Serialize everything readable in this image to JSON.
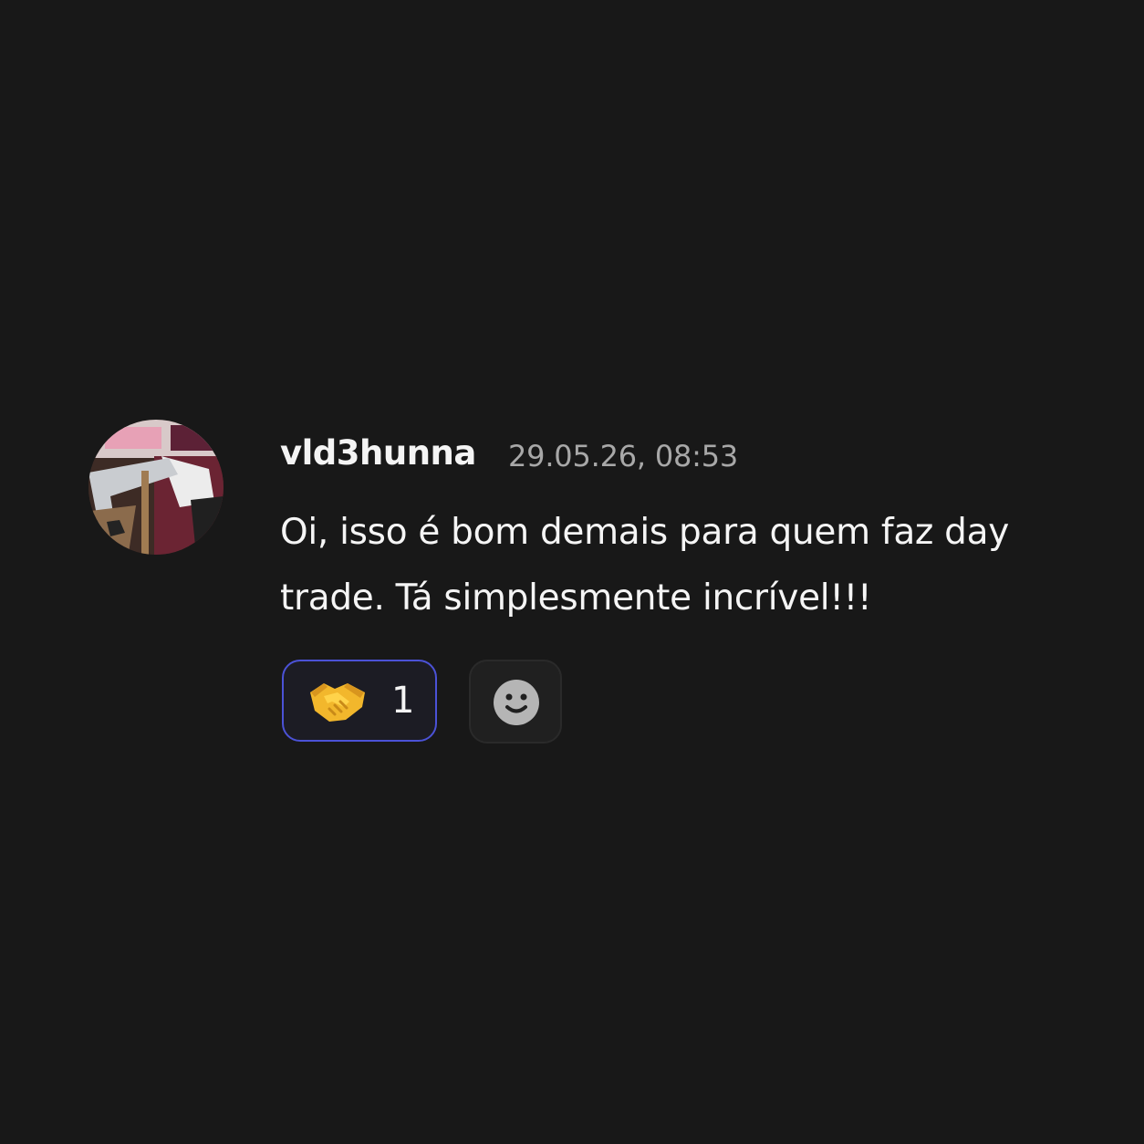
{
  "message": {
    "username": "vld3hunna",
    "timestamp": "29.05.26, 08:53",
    "text": "Oi, isso é bom demais para quem faz day trade. Tá simplesmente incrível!!!",
    "avatar_icon": "user-photo-avatar"
  },
  "reactions": [
    {
      "emoji_icon": "handshake-icon",
      "count": "1",
      "active": true,
      "accent_color": "#4b52d6"
    }
  ],
  "add_reaction": {
    "icon": "smiley-face-icon"
  },
  "colors": {
    "background": "#181818",
    "text_primary": "#f5f5f5",
    "text_secondary": "#a8a8a8",
    "accent": "#4b52d6"
  }
}
